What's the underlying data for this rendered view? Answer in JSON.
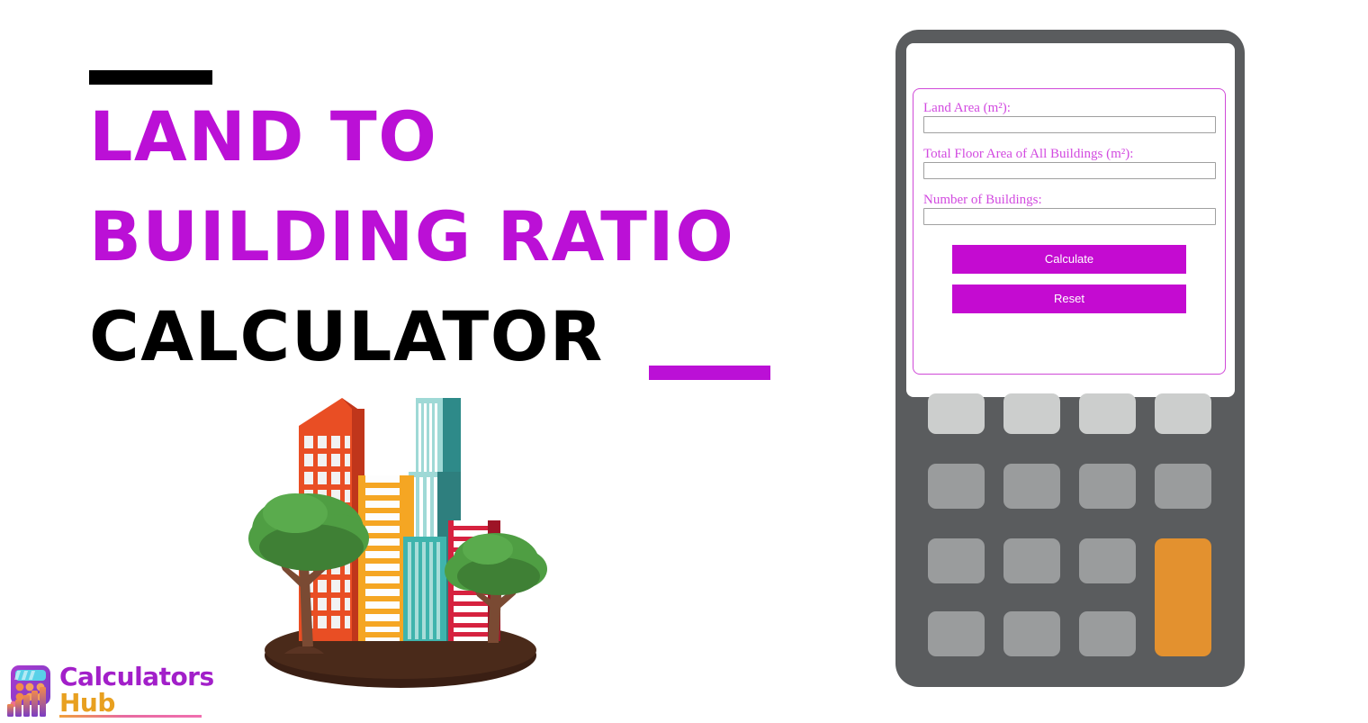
{
  "page": {
    "background": "#ffffff",
    "accent_magenta": "#bb10d6",
    "accent_black": "#000000",
    "calculator_body": "#5a5c5e",
    "key_light": "#cccecd",
    "key_dark": "#9a9c9d",
    "key_accent_orange": "#e3912f"
  },
  "hero": {
    "title_line_1": "LAND TO",
    "title_line_2": "BUILDING RATIO",
    "title_line_3": "CALCULATOR",
    "accent_bar_top": "",
    "accent_bar_bottom": ""
  },
  "logo": {
    "word_1": "Calculators",
    "word_2": "Hub",
    "word_1_color": "#a21fc9",
    "word_2_color": "#e8a020"
  },
  "illustration": {
    "name": "city-buildings-with-trees",
    "colors": {
      "red_tower": "#e94e24",
      "red_tower_shade": "#c0361b",
      "orange_tower": "#f5a623",
      "orange_tower_light": "#f9b233",
      "teal_tower": "#2ea3a0",
      "teal_tower_shade": "#227f7d",
      "teal_light": "#7fd0cd",
      "crimson_tower": "#d6223f",
      "crimson_shade": "#9e1427",
      "tree_foliage": "#4f9e43",
      "tree_foliage_dark": "#3f8035",
      "tree_trunk": "#7a4a33",
      "ground": "#3a1f14"
    }
  },
  "calculator": {
    "form": {
      "fields": [
        {
          "label": "Land Area (m²):",
          "value": "",
          "placeholder": ""
        },
        {
          "label": "Total Floor Area of All Buildings (m²):",
          "value": "",
          "placeholder": ""
        },
        {
          "label": "Number of Buildings:",
          "value": "",
          "placeholder": ""
        }
      ],
      "calculate_label": "Calculate",
      "reset_label": "Reset",
      "label_color": "#d24ae0",
      "button_color": "#c40bd1"
    },
    "keypad": {
      "rows": 4,
      "cols": 4,
      "row_1_style": "light",
      "other_rows_style": "dark",
      "accent_key": "tall-orange-key-column-4-rows-3-4"
    }
  }
}
